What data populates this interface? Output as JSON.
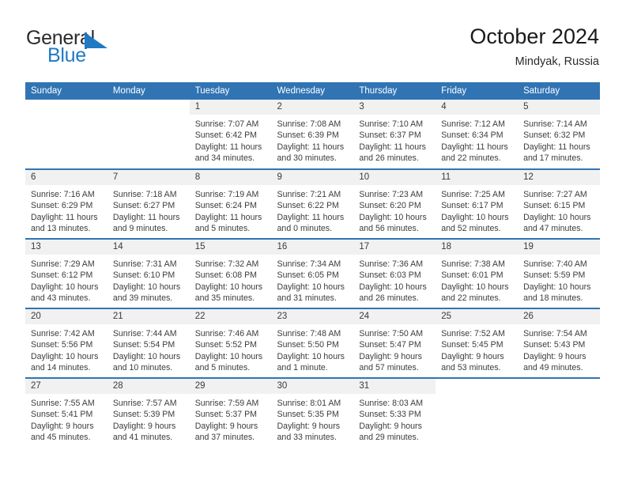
{
  "brand": {
    "name_part1": "General",
    "name_part2": "Blue",
    "flag_color": "#1f7ac4"
  },
  "header": {
    "title": "October 2024",
    "subtitle": "Mindyak, Russia"
  },
  "theme": {
    "header_blue": "#3174b4",
    "daynum_band": "#f1f1f1",
    "text": "#3c3c3c"
  },
  "weekday_headers": [
    "Sunday",
    "Monday",
    "Tuesday",
    "Wednesday",
    "Thursday",
    "Friday",
    "Saturday"
  ],
  "weeks": [
    [
      {
        "day": "",
        "sunrise": "",
        "sunset": "",
        "daylight": "",
        "daylight2": ""
      },
      {
        "day": "",
        "sunrise": "",
        "sunset": "",
        "daylight": "",
        "daylight2": ""
      },
      {
        "day": "1",
        "sunrise": "Sunrise: 7:07 AM",
        "sunset": "Sunset: 6:42 PM",
        "daylight": "Daylight: 11 hours",
        "daylight2": "and 34 minutes."
      },
      {
        "day": "2",
        "sunrise": "Sunrise: 7:08 AM",
        "sunset": "Sunset: 6:39 PM",
        "daylight": "Daylight: 11 hours",
        "daylight2": "and 30 minutes."
      },
      {
        "day": "3",
        "sunrise": "Sunrise: 7:10 AM",
        "sunset": "Sunset: 6:37 PM",
        "daylight": "Daylight: 11 hours",
        "daylight2": "and 26 minutes."
      },
      {
        "day": "4",
        "sunrise": "Sunrise: 7:12 AM",
        "sunset": "Sunset: 6:34 PM",
        "daylight": "Daylight: 11 hours",
        "daylight2": "and 22 minutes."
      },
      {
        "day": "5",
        "sunrise": "Sunrise: 7:14 AM",
        "sunset": "Sunset: 6:32 PM",
        "daylight": "Daylight: 11 hours",
        "daylight2": "and 17 minutes."
      }
    ],
    [
      {
        "day": "6",
        "sunrise": "Sunrise: 7:16 AM",
        "sunset": "Sunset: 6:29 PM",
        "daylight": "Daylight: 11 hours",
        "daylight2": "and 13 minutes."
      },
      {
        "day": "7",
        "sunrise": "Sunrise: 7:18 AM",
        "sunset": "Sunset: 6:27 PM",
        "daylight": "Daylight: 11 hours",
        "daylight2": "and 9 minutes."
      },
      {
        "day": "8",
        "sunrise": "Sunrise: 7:19 AM",
        "sunset": "Sunset: 6:24 PM",
        "daylight": "Daylight: 11 hours",
        "daylight2": "and 5 minutes."
      },
      {
        "day": "9",
        "sunrise": "Sunrise: 7:21 AM",
        "sunset": "Sunset: 6:22 PM",
        "daylight": "Daylight: 11 hours",
        "daylight2": "and 0 minutes."
      },
      {
        "day": "10",
        "sunrise": "Sunrise: 7:23 AM",
        "sunset": "Sunset: 6:20 PM",
        "daylight": "Daylight: 10 hours",
        "daylight2": "and 56 minutes."
      },
      {
        "day": "11",
        "sunrise": "Sunrise: 7:25 AM",
        "sunset": "Sunset: 6:17 PM",
        "daylight": "Daylight: 10 hours",
        "daylight2": "and 52 minutes."
      },
      {
        "day": "12",
        "sunrise": "Sunrise: 7:27 AM",
        "sunset": "Sunset: 6:15 PM",
        "daylight": "Daylight: 10 hours",
        "daylight2": "and 47 minutes."
      }
    ],
    [
      {
        "day": "13",
        "sunrise": "Sunrise: 7:29 AM",
        "sunset": "Sunset: 6:12 PM",
        "daylight": "Daylight: 10 hours",
        "daylight2": "and 43 minutes."
      },
      {
        "day": "14",
        "sunrise": "Sunrise: 7:31 AM",
        "sunset": "Sunset: 6:10 PM",
        "daylight": "Daylight: 10 hours",
        "daylight2": "and 39 minutes."
      },
      {
        "day": "15",
        "sunrise": "Sunrise: 7:32 AM",
        "sunset": "Sunset: 6:08 PM",
        "daylight": "Daylight: 10 hours",
        "daylight2": "and 35 minutes."
      },
      {
        "day": "16",
        "sunrise": "Sunrise: 7:34 AM",
        "sunset": "Sunset: 6:05 PM",
        "daylight": "Daylight: 10 hours",
        "daylight2": "and 31 minutes."
      },
      {
        "day": "17",
        "sunrise": "Sunrise: 7:36 AM",
        "sunset": "Sunset: 6:03 PM",
        "daylight": "Daylight: 10 hours",
        "daylight2": "and 26 minutes."
      },
      {
        "day": "18",
        "sunrise": "Sunrise: 7:38 AM",
        "sunset": "Sunset: 6:01 PM",
        "daylight": "Daylight: 10 hours",
        "daylight2": "and 22 minutes."
      },
      {
        "day": "19",
        "sunrise": "Sunrise: 7:40 AM",
        "sunset": "Sunset: 5:59 PM",
        "daylight": "Daylight: 10 hours",
        "daylight2": "and 18 minutes."
      }
    ],
    [
      {
        "day": "20",
        "sunrise": "Sunrise: 7:42 AM",
        "sunset": "Sunset: 5:56 PM",
        "daylight": "Daylight: 10 hours",
        "daylight2": "and 14 minutes."
      },
      {
        "day": "21",
        "sunrise": "Sunrise: 7:44 AM",
        "sunset": "Sunset: 5:54 PM",
        "daylight": "Daylight: 10 hours",
        "daylight2": "and 10 minutes."
      },
      {
        "day": "22",
        "sunrise": "Sunrise: 7:46 AM",
        "sunset": "Sunset: 5:52 PM",
        "daylight": "Daylight: 10 hours",
        "daylight2": "and 5 minutes."
      },
      {
        "day": "23",
        "sunrise": "Sunrise: 7:48 AM",
        "sunset": "Sunset: 5:50 PM",
        "daylight": "Daylight: 10 hours",
        "daylight2": "and 1 minute."
      },
      {
        "day": "24",
        "sunrise": "Sunrise: 7:50 AM",
        "sunset": "Sunset: 5:47 PM",
        "daylight": "Daylight: 9 hours",
        "daylight2": "and 57 minutes."
      },
      {
        "day": "25",
        "sunrise": "Sunrise: 7:52 AM",
        "sunset": "Sunset: 5:45 PM",
        "daylight": "Daylight: 9 hours",
        "daylight2": "and 53 minutes."
      },
      {
        "day": "26",
        "sunrise": "Sunrise: 7:54 AM",
        "sunset": "Sunset: 5:43 PM",
        "daylight": "Daylight: 9 hours",
        "daylight2": "and 49 minutes."
      }
    ],
    [
      {
        "day": "27",
        "sunrise": "Sunrise: 7:55 AM",
        "sunset": "Sunset: 5:41 PM",
        "daylight": "Daylight: 9 hours",
        "daylight2": "and 45 minutes."
      },
      {
        "day": "28",
        "sunrise": "Sunrise: 7:57 AM",
        "sunset": "Sunset: 5:39 PM",
        "daylight": "Daylight: 9 hours",
        "daylight2": "and 41 minutes."
      },
      {
        "day": "29",
        "sunrise": "Sunrise: 7:59 AM",
        "sunset": "Sunset: 5:37 PM",
        "daylight": "Daylight: 9 hours",
        "daylight2": "and 37 minutes."
      },
      {
        "day": "30",
        "sunrise": "Sunrise: 8:01 AM",
        "sunset": "Sunset: 5:35 PM",
        "daylight": "Daylight: 9 hours",
        "daylight2": "and 33 minutes."
      },
      {
        "day": "31",
        "sunrise": "Sunrise: 8:03 AM",
        "sunset": "Sunset: 5:33 PM",
        "daylight": "Daylight: 9 hours",
        "daylight2": "and 29 minutes."
      },
      {
        "day": "",
        "sunrise": "",
        "sunset": "",
        "daylight": "",
        "daylight2": ""
      },
      {
        "day": "",
        "sunrise": "",
        "sunset": "",
        "daylight": "",
        "daylight2": ""
      }
    ]
  ]
}
